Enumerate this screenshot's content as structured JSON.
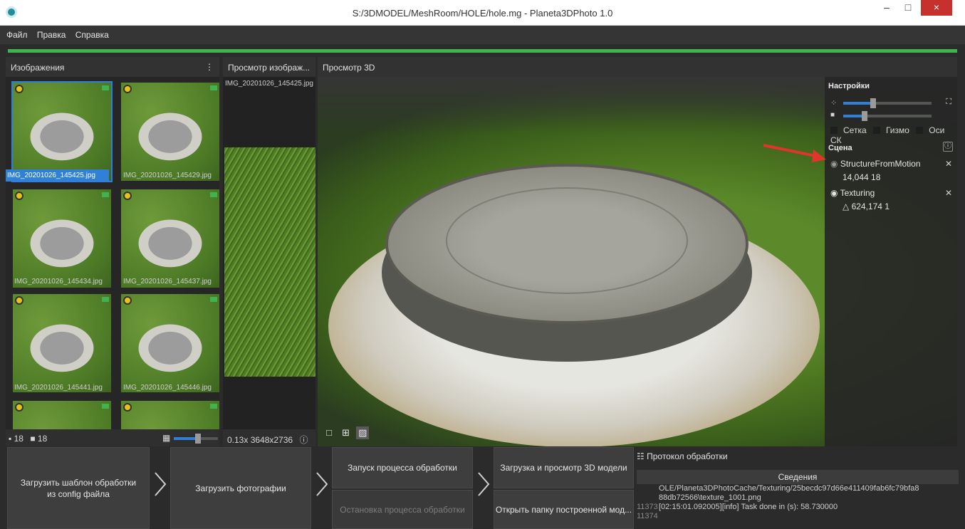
{
  "window": {
    "title": "S:/3DMODEL/MeshRoom/HOLE/hole.mg - Planeta3DPhoto 1.0",
    "min": "–",
    "max": "□",
    "close": "×"
  },
  "menu": [
    "Файл",
    "Правка",
    "Справка"
  ],
  "images_panel": {
    "title": "Изображения",
    "more_icon": "⋮",
    "thumbnails": [
      "IMG_20201026_145425.jpg",
      "IMG_20201026_145429.jpg",
      "IMG_20201026_145434.jpg",
      "IMG_20201026_145437.jpg",
      "IMG_20201026_145441.jpg",
      "IMG_20201026_145446.jpg"
    ],
    "footer": {
      "images_count": "18",
      "cameras_count": "18"
    }
  },
  "image_viewer": {
    "title": "Просмотр изображ...",
    "filename": "IMG_20201026_145425.jpg",
    "footer": "0.13x 3648x2736"
  },
  "viewer3d": {
    "title": "Просмотр 3D",
    "settings": {
      "title": "Настройки",
      "checkboxes": [
        "Сетка",
        "Гизмо",
        "Оси СК"
      ]
    },
    "scene": {
      "title": "Сцена",
      "items": [
        {
          "name": "StructureFromMotion",
          "stats": "14,044  18"
        },
        {
          "name": "Texturing",
          "stats": "△ 624,174  1"
        }
      ]
    }
  },
  "toolbar": {
    "load_template": "Загрузить шаблон обработки из config файла",
    "load_photos": "Загрузить фотографии",
    "start_processing": "Запуск процесса обработки",
    "stop_processing": "Остановка процесса обработки",
    "load_view_3d": "Загрузка и просмотр 3D модели",
    "open_folder": "Открыть папку построенной мод..."
  },
  "log": {
    "title": "Протокол обработки",
    "tab": "Сведения",
    "lines": [
      {
        "num": "",
        "text": "OLE/Planeta3DPhotoCache/Texturing/25becdc97d66e411409fab6fc79bfa8"
      },
      {
        "num": "",
        "text": "88db72566\\texture_1001.png"
      },
      {
        "num": "11373",
        "text": "[02:15:01.092005][info] Task done in (s): 58.730000"
      },
      {
        "num": "11374",
        "text": ""
      }
    ]
  }
}
